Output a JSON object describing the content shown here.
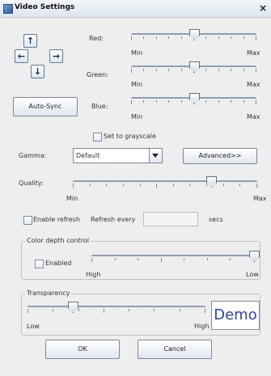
{
  "window": {
    "title": "Video Settings",
    "close_glyph": "×"
  },
  "arrows": {
    "up": "↑",
    "left": "←",
    "right": "→",
    "down": "↓"
  },
  "buttons": {
    "auto_sync": "Auto-Sync",
    "advanced": "Advanced>>",
    "ok": "OK",
    "cancel": "Cancel"
  },
  "color_sliders": {
    "red": {
      "label": "Red:",
      "level": 0.5,
      "min": "Min",
      "max": "Max"
    },
    "green": {
      "label": "Green:",
      "level": 0.5,
      "min": "Min",
      "max": "Max"
    },
    "blue": {
      "label": "Blue:",
      "level": 0.5,
      "min": "Min",
      "max": "Max"
    }
  },
  "grayscale": {
    "label": "Set to grayscale",
    "checked": false
  },
  "gamma": {
    "label": "Gamma:",
    "value": "Default"
  },
  "quality": {
    "label": "Quality:",
    "level": 0.75,
    "min": "Min",
    "max": "Max"
  },
  "refresh": {
    "enable_label": "Enable refresh",
    "checked": false,
    "every_label": "Refresh every",
    "value": "",
    "unit": "secs"
  },
  "color_depth": {
    "legend": "Color depth control",
    "enabled_label": "Enabled",
    "checked": false,
    "level": 1.0,
    "high": "High",
    "low": "Low"
  },
  "transparency": {
    "legend": "Transparency",
    "level": 0.25,
    "low": "Low",
    "high": "High",
    "demo_text": "Demo"
  },
  "colors": {
    "accent": "#2a3fd6",
    "titlebar": "#dde5ee",
    "background": "#eeeeee"
  }
}
